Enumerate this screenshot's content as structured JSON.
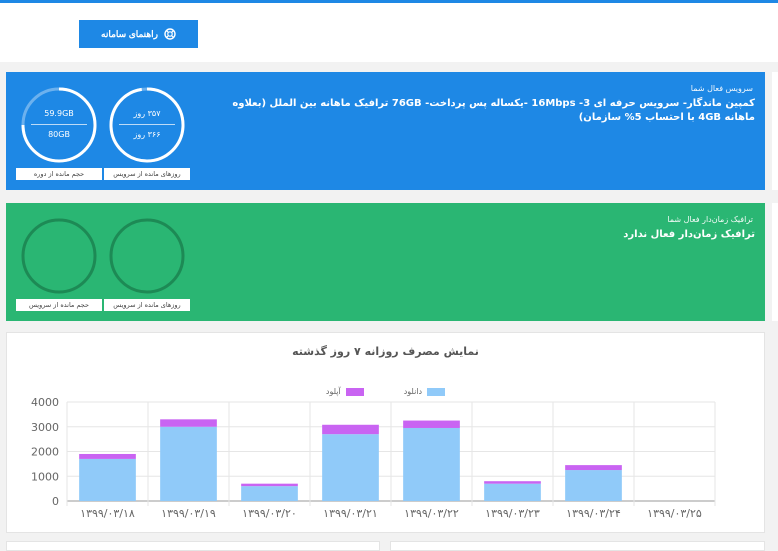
{
  "header": {
    "guide_button_label": "راهنمای سامانه"
  },
  "active_service": {
    "title": "سرویس فعال شما",
    "description": "کمپین ماندگار- سرویس حرفه ای 3- 16Mbps -یکساله پس پرداخت- 76GB ترافیک ماهانه بین الملل (بعلاوه ماهانه 4GB با احتساب 5% سازمان)",
    "days_gauge": {
      "remaining": "۳۵۷ روز",
      "total": "۳۶۶ روز",
      "label": "روزهای مانده از سرویس",
      "fraction": 0.975
    },
    "volume_gauge": {
      "remaining": "59.9GB",
      "total": "80GB",
      "label": "حجم مانده از دوره",
      "fraction": 0.749
    }
  },
  "timed_traffic": {
    "title": "ترافیک زمان‌دار فعال شما",
    "message": "ترافیک زمان‌دار فعال ندارد",
    "days_label": "روزهای مانده از سرویس",
    "volume_label": "حجم مانده از سرویس"
  },
  "colors": {
    "blue": "#1e88e5",
    "green": "#2ab673",
    "download": "#90caf9",
    "upload": "#c964f2"
  },
  "chart_data": {
    "type": "bar",
    "stacked": true,
    "title": "نمایش مصرف روزانه ۷ روز گذشته",
    "categories": [
      "۱۳۹۹/۰۳/۱۸",
      "۱۳۹۹/۰۳/۱۹",
      "۱۳۹۹/۰۳/۲۰",
      "۱۳۹۹/۰۳/۲۱",
      "۱۳۹۹/۰۳/۲۲",
      "۱۳۹۹/۰۳/۲۳",
      "۱۳۹۹/۰۳/۲۴",
      "۱۳۹۹/۰۳/۲۵"
    ],
    "series": [
      {
        "name": "دانلود",
        "values": [
          1700,
          3000,
          600,
          2700,
          2950,
          700,
          1250,
          0
        ]
      },
      {
        "name": "آپلود",
        "values": [
          200,
          300,
          100,
          380,
          300,
          100,
          200,
          0
        ]
      }
    ],
    "ylim": [
      0,
      4000
    ],
    "yticks": [
      "0",
      "1000",
      "2000",
      "3000",
      "4000"
    ],
    "grid": true,
    "legend": "top-center"
  }
}
